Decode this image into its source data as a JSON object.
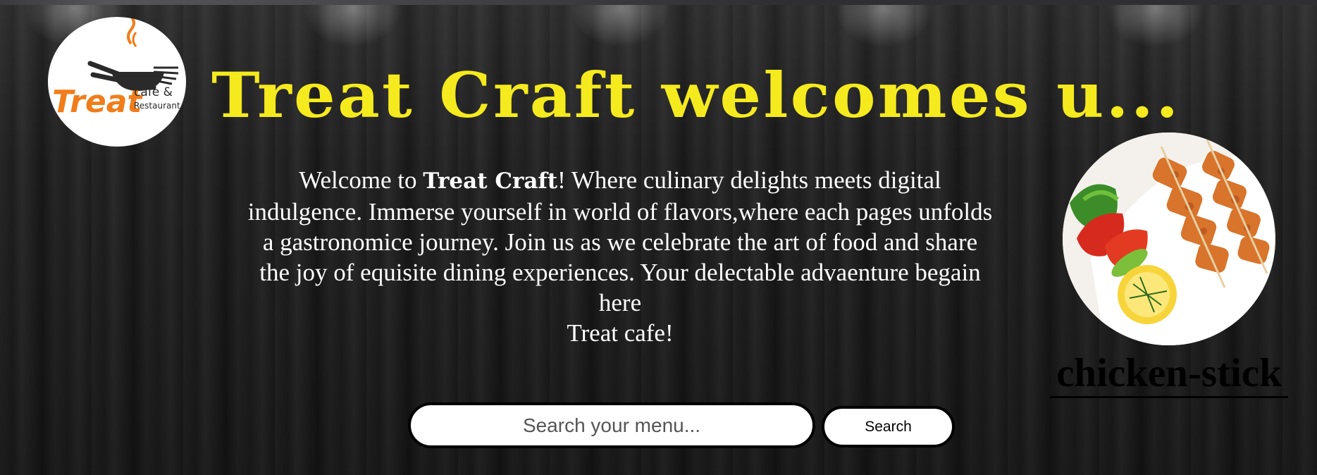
{
  "logo": {
    "icon": "fork-and-pan-icon",
    "word": "Treat",
    "subtitle_1": "cafe &",
    "subtitle_2": "Restaurant"
  },
  "header": {
    "title": "Treat Craft welcomes u..."
  },
  "intro": {
    "text_before": "Welcome to ",
    "brand": "Treat Craft",
    "text_after": "! Where culinary delights meets digital indulgence. Immerse yourself in world of flavors,where each pages unfolds a gastronomice journey. Join us as we celebrate the art of food and share the joy of equisite dining experiences. Your delectable advaenture begain here",
    "closing": "Treat cafe!"
  },
  "featured": {
    "caption": "chicken-stick"
  },
  "search": {
    "placeholder": "Search your menu...",
    "value": "",
    "button_label": "Search"
  },
  "colors": {
    "headline": "#f5ea1e",
    "logo_orange": "#f07d1a",
    "body_text": "#ffffff"
  }
}
